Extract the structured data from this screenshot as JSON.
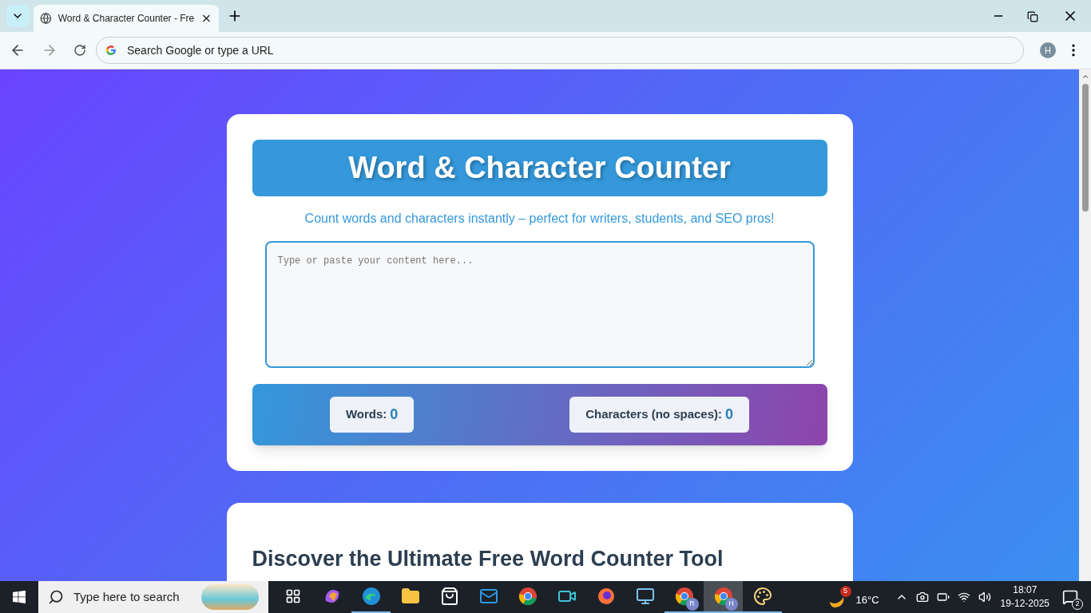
{
  "browser": {
    "tab": {
      "title": "Word & Character Counter - Fre",
      "selected": true
    },
    "address": {
      "placeholder": "Search Google or type a URL"
    },
    "profile": "H"
  },
  "tool": {
    "title": "Word & Character Counter",
    "subtitle": "Count words and characters instantly – perfect for writers, students, and SEO pros!",
    "editor": {
      "placeholder": "Type or paste your content here..."
    },
    "stats": [
      {
        "label": "Words:",
        "value": "0"
      },
      {
        "label": "Characters (no spaces):",
        "value": "0"
      }
    ]
  },
  "article": {
    "heading": "Discover the Ultimate Free Word Counter Tool"
  },
  "taskbar": {
    "search": {
      "placeholder": "Type here to search"
    },
    "apps": [
      {
        "kind": "taskview",
        "running": false,
        "selected": false
      },
      {
        "kind": "copilot",
        "running": false,
        "selected": false
      },
      {
        "kind": "edge",
        "running": true,
        "selected": false
      },
      {
        "kind": "folder",
        "running": false,
        "selected": false
      },
      {
        "kind": "store",
        "running": false,
        "selected": false
      },
      {
        "kind": "mail",
        "running": false,
        "selected": false
      },
      {
        "kind": "chrome",
        "running": false,
        "selected": false
      },
      {
        "kind": "camera",
        "running": false,
        "selected": false
      },
      {
        "kind": "firefox",
        "running": false,
        "selected": false
      },
      {
        "kind": "computer",
        "running": false,
        "selected": false
      },
      {
        "kind": "chrome",
        "badge": "R",
        "running": true,
        "selected": false
      },
      {
        "kind": "chrome",
        "badge": "H",
        "running": true,
        "selected": true
      },
      {
        "kind": "paint",
        "running": true,
        "selected": false
      }
    ],
    "weather": {
      "badge": "5",
      "temperature": "16°C"
    },
    "time": "18:07",
    "date": "19-12-2025",
    "notifications": "2"
  }
}
